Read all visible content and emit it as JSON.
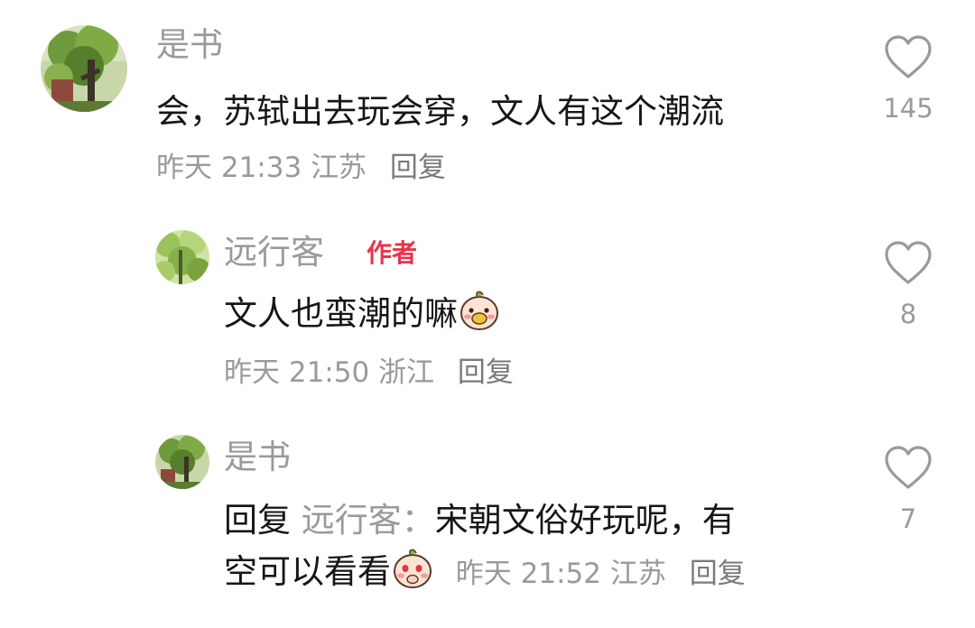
{
  "comments": [
    {
      "username": "是书",
      "content": "会，苏轼出去玩会穿，文人有这个潮流",
      "time": "昨天 21:33",
      "location": "江苏",
      "reply_label": "回复",
      "likes": "145",
      "avatar_icon": "tree-photo-avatar"
    },
    {
      "username": "远行客",
      "badge": "作者",
      "content": "文人也蛮潮的嘛",
      "emoji_icon": "peach-eating-emoji",
      "time": "昨天 21:50",
      "location": "浙江",
      "reply_label": "回复",
      "likes": "8",
      "avatar_icon": "green-leaves-avatar"
    },
    {
      "username": "是书",
      "reply_prefix": "回复",
      "reply_to": "远行客：",
      "content_line1": "宋朝文俗好玩呢，有",
      "content_line2": "空可以看看",
      "emoji_icon": "peach-shy-emoji",
      "time": "昨天 21:52",
      "location": "江苏",
      "reply_label": "回复",
      "likes": "7",
      "avatar_icon": "tree-photo-avatar"
    }
  ],
  "colors": {
    "name": "#9a9a9a",
    "text": "#161616",
    "author_badge": "#e8344a"
  }
}
